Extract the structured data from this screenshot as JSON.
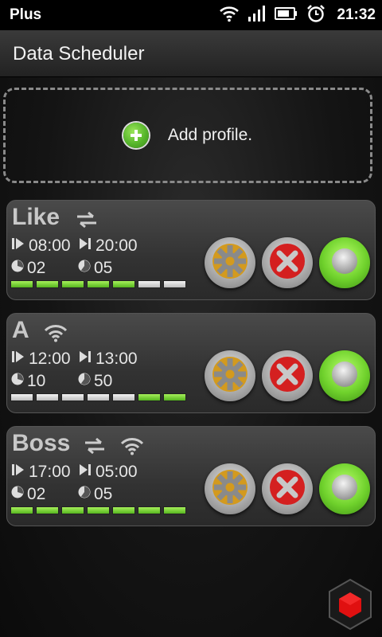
{
  "status_bar": {
    "carrier": "Plus",
    "time": "21:32",
    "icons": [
      "wifi-icon",
      "signal-icon",
      "battery-icon",
      "alarm-icon"
    ]
  },
  "app": {
    "title": "Data Scheduler"
  },
  "add_profile": {
    "label": "Add profile."
  },
  "profiles": [
    {
      "name": "Like",
      "icons": [
        "transfer-arrows-icon"
      ],
      "start_time": "08:00",
      "end_time": "20:00",
      "value_a": "02",
      "value_b": "05",
      "bars": [
        1,
        1,
        1,
        1,
        1,
        0,
        0
      ]
    },
    {
      "name": "A",
      "icons": [
        "wifi-icon"
      ],
      "start_time": "12:00",
      "end_time": "13:00",
      "value_a": "10",
      "value_b": "50",
      "bars": [
        0,
        0,
        0,
        0,
        0,
        1,
        1
      ]
    },
    {
      "name": "Boss",
      "icons": [
        "transfer-arrows-icon",
        "wifi-icon"
      ],
      "start_time": "17:00",
      "end_time": "05:00",
      "value_a": "02",
      "value_b": "05",
      "bars": [
        1,
        1,
        1,
        1,
        1,
        1,
        1
      ]
    }
  ],
  "colors": {
    "active_bar": "#7ed63a",
    "inactive_bar": "#d9d9d9",
    "toggle_on": "#6fd12c",
    "delete": "#d42020",
    "settings": "#d39a1e",
    "hex_accent": "#e01010"
  }
}
